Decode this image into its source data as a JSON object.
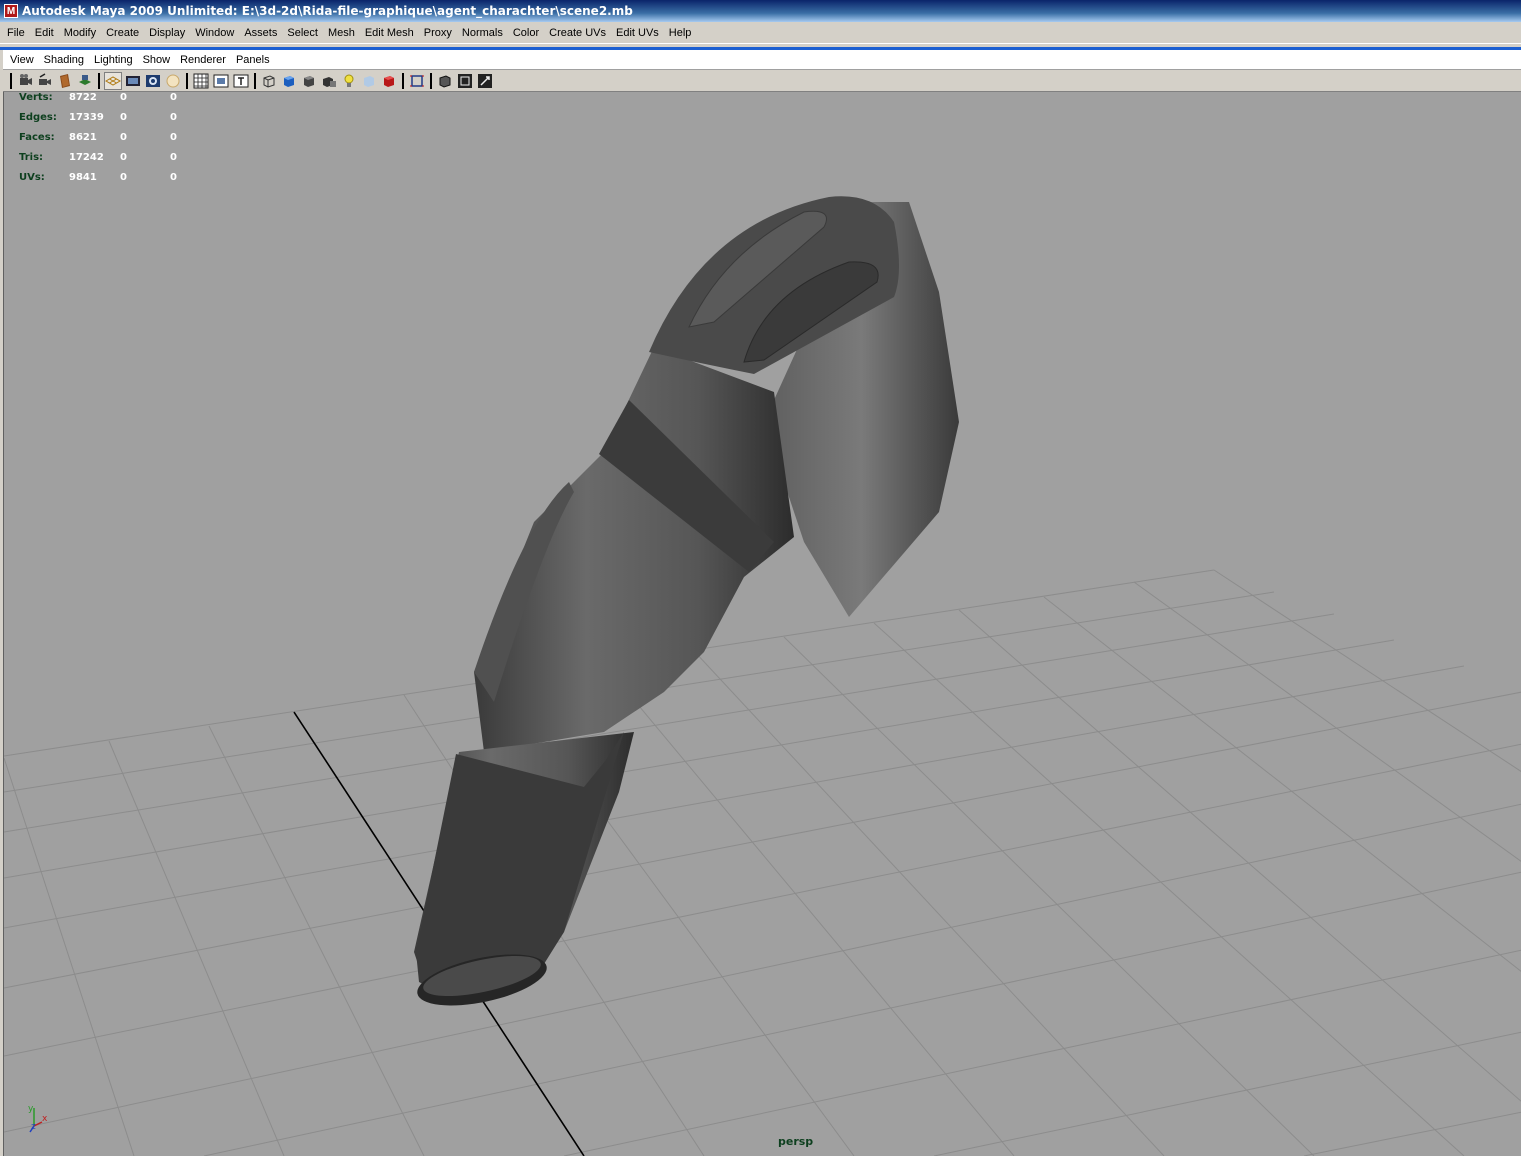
{
  "window": {
    "title": "Autodesk Maya 2009 Unlimited: E:\\3d-2d\\Rida-file-graphique\\agent_charachter\\scene2.mb",
    "icon": "maya-logo-icon"
  },
  "menubar": {
    "items": [
      "File",
      "Edit",
      "Modify",
      "Create",
      "Display",
      "Window",
      "Assets",
      "Select",
      "Mesh",
      "Edit Mesh",
      "Proxy",
      "Normals",
      "Color",
      "Create UVs",
      "Edit UVs",
      "Help"
    ]
  },
  "panel_menu": {
    "items": [
      "View",
      "Shading",
      "Lighting",
      "Show",
      "Renderer",
      "Panels"
    ]
  },
  "panel_toolbar": {
    "icons": [
      "camera-select-icon",
      "camera-attributes-icon",
      "bookmark-icon",
      "image-plane-icon",
      "grid-toggle-icon",
      "film-gate-icon",
      "resolution-gate-icon",
      "gate-mask-icon",
      "field-chart-icon",
      "safe-action-icon",
      "safe-title-icon",
      "wireframe-icon",
      "smooth-shade-icon",
      "default-lighting-icon",
      "shadows-icon",
      "light-icon",
      "xray-icon",
      "textured-icon",
      "isolate-select-icon",
      "frame-all-icon",
      "frame-selection-icon",
      "camera-tumble-icon"
    ]
  },
  "hud": {
    "rows": [
      {
        "label": "Verts:",
        "values": [
          "8722",
          "0",
          "0"
        ]
      },
      {
        "label": "Edges:",
        "values": [
          "17339",
          "0",
          "0"
        ]
      },
      {
        "label": "Faces:",
        "values": [
          "8621",
          "0",
          "0"
        ]
      },
      {
        "label": "Tris:",
        "values": [
          "17242",
          "0",
          "0"
        ]
      },
      {
        "label": "UVs:",
        "values": [
          "9841",
          "0",
          "0"
        ]
      }
    ]
  },
  "viewport": {
    "camera_label": "persp",
    "axis_labels": {
      "x": "x",
      "y": "y",
      "z": "z"
    },
    "background_color": "#a0a0a0"
  },
  "colors": {
    "title_gradient_start": "#0a246a",
    "panel_border": "#1c5fd1",
    "hud_label": "#0d3f1e"
  }
}
